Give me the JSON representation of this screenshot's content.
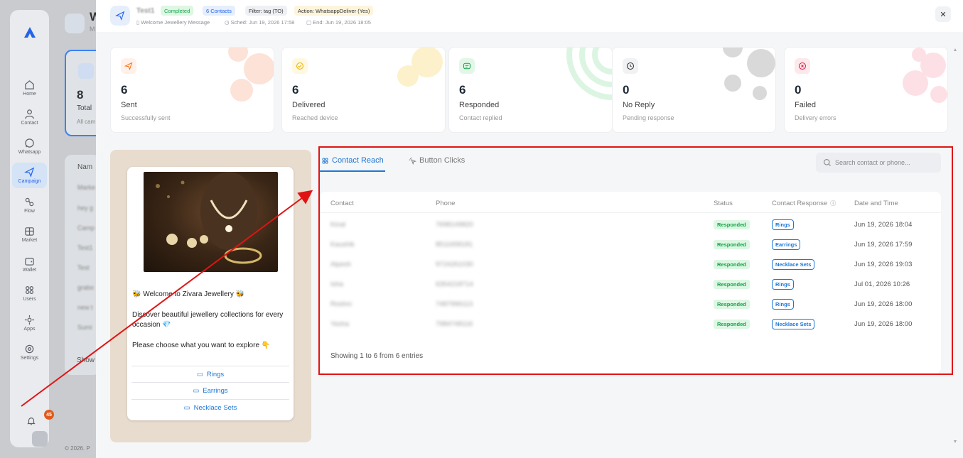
{
  "sidebar": {
    "items": [
      {
        "label": "Home",
        "icon": "home-icon"
      },
      {
        "label": "Contact",
        "icon": "contact-icon"
      },
      {
        "label": "Whatsapp",
        "icon": "whatsapp-icon"
      },
      {
        "label": "Campaign",
        "icon": "campaign-icon"
      },
      {
        "label": "Flow",
        "icon": "flow-icon"
      },
      {
        "label": "Market",
        "icon": "market-icon"
      },
      {
        "label": "Wallet",
        "icon": "wallet-icon"
      },
      {
        "label": "Users",
        "icon": "users-icon"
      },
      {
        "label": "Apps",
        "icon": "apps-icon"
      },
      {
        "label": "Settings",
        "icon": "settings-icon"
      }
    ],
    "notification_count": "45"
  },
  "background": {
    "header_title": "W",
    "header_sub": "M",
    "card_value": "8",
    "card_label": "Total",
    "card_sub": "All cam",
    "table_header": "Nam",
    "rows": [
      "Marke",
      "hey g",
      "Camp",
      "Test1",
      "Test",
      "grabo",
      "new t",
      "Sumi"
    ],
    "showing": "Show",
    "footer": "© 2026. P"
  },
  "modal": {
    "title": "Test1",
    "status_pill": "Completed",
    "contacts_pill": "6 Contacts",
    "filter_pill": "Filter: tag (TO)",
    "action_pill": "Action: WhatsappDeliver (Yes)",
    "template": "Welcome Jewellery Message",
    "sched": "Sched: Jun 19, 2026 17:58",
    "end": "End: Jun 19, 2026 18:05",
    "close": "✕"
  },
  "stats": [
    {
      "value": "6",
      "label": "Sent",
      "sub": "Successfully sent",
      "color": "#f97316"
    },
    {
      "value": "6",
      "label": "Delivered",
      "sub": "Reached device",
      "color": "#eab308"
    },
    {
      "value": "6",
      "label": "Responded",
      "sub": "Contact replied",
      "color": "#16a34a"
    },
    {
      "value": "0",
      "label": "No Reply",
      "sub": "Pending response",
      "color": "#555555"
    },
    {
      "value": "0",
      "label": "Failed",
      "sub": "Delivery errors",
      "color": "#e11d48"
    }
  ],
  "preview": {
    "line1": "🐝 Welcome to Zivara Jewellery 🐝",
    "line2": "Discover beautiful jewellery collections for every occasion 💎",
    "line3": "Please choose what you want to explore 👇",
    "buttons": [
      "Rings",
      "Earrings",
      "Necklace Sets"
    ]
  },
  "panel": {
    "tab_active": "Contact Reach",
    "tab_inactive": "Button Clicks",
    "search_placeholder": "Search contact or phone...",
    "columns": [
      "Contact",
      "Phone",
      "Status",
      "Contact Response",
      "Date and Time"
    ],
    "rows": [
      {
        "contact": "Kinal",
        "phone": "7698149820",
        "status": "Responded",
        "response": "Rings",
        "date": "Jun 19, 2026 18:04"
      },
      {
        "contact": "Kaushik",
        "phone": "8511658181",
        "status": "Responded",
        "response": "Earrings",
        "date": "Jun 19, 2026 17:59"
      },
      {
        "contact": "Alpesh",
        "phone": "9724261030",
        "status": "Responded",
        "response": "Necklace Sets",
        "date": "Jun 19, 2026 19:03"
      },
      {
        "contact": "Isha",
        "phone": "6354218714",
        "status": "Responded",
        "response": "Rings",
        "date": "Jul 01, 2026 10:26"
      },
      {
        "contact": "Roshni",
        "phone": "7487996113",
        "status": "Responded",
        "response": "Rings",
        "date": "Jun 19, 2026 18:00"
      },
      {
        "contact": "Yesha",
        "phone": "7984748116",
        "status": "Responded",
        "response": "Necklace Sets",
        "date": "Jun 19, 2026 18:00"
      }
    ],
    "showing": "Showing 1 to 6 from 6 entries"
  },
  "colors": {
    "accent": "#1d77d6",
    "highlight": "#e01414"
  }
}
